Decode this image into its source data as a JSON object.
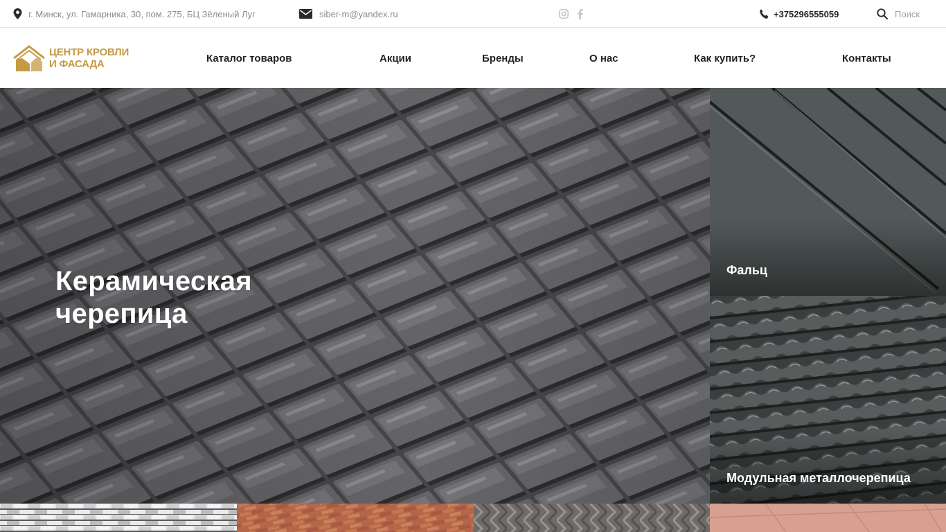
{
  "topbar": {
    "address": "г. Минск, ул. Гамарника, 30, пом. 275, БЦ Зёленый Луг",
    "email": "siber-m@yandex.ru",
    "phone": "+375296555059",
    "search_placeholder": "Поиск",
    "icons": [
      "location-pin-icon",
      "mail-icon",
      "instagram-icon",
      "facebook-icon",
      "phone-icon",
      "search-icon"
    ]
  },
  "logo": {
    "line1": "ЦЕНТР КРОВЛИ",
    "line2": "И ФАСАДА",
    "color": "#c49a45"
  },
  "nav": {
    "items": [
      {
        "label": "Каталог товаров"
      },
      {
        "label": "Акции"
      },
      {
        "label": "Бренды"
      },
      {
        "label": "О нас"
      },
      {
        "label": "Как купить?"
      },
      {
        "label": "Контакты"
      }
    ]
  },
  "hero": {
    "title_line1": "Керамическая",
    "title_line2": "черепица"
  },
  "cards": [
    {
      "title": "Фальц"
    },
    {
      "title": "Модульная металлочерепица"
    }
  ]
}
